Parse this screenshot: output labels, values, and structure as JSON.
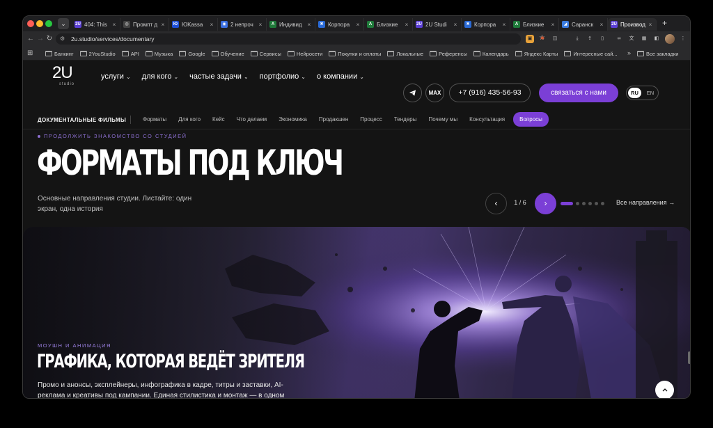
{
  "browser": {
    "tabs": [
      {
        "title": "404: This",
        "fav": "2U",
        "color": "#5b3fd6",
        "active": false
      },
      {
        "title": "Промпт д",
        "fav": "◎",
        "color": "#444",
        "active": false
      },
      {
        "title": "ЮKassa",
        "fav": "Ю",
        "color": "#1e4fd6",
        "active": false
      },
      {
        "title": "2 непроч",
        "fav": "◉",
        "color": "#3b6fe0",
        "active": false
      },
      {
        "title": "Индивид",
        "fav": "A",
        "color": "#1f7a3a",
        "active": false
      },
      {
        "title": "Корпора",
        "fav": "✖",
        "color": "#2a6ad6",
        "active": false
      },
      {
        "title": "Близкие",
        "fav": "A",
        "color": "#1f7a3a",
        "active": false
      },
      {
        "title": "2U Studi",
        "fav": "2U",
        "color": "#5b3fd6",
        "active": false
      },
      {
        "title": "Корпора",
        "fav": "✖",
        "color": "#2a6ad6",
        "active": false
      },
      {
        "title": "Близкие",
        "fav": "A",
        "color": "#1f7a3a",
        "active": false
      },
      {
        "title": "Саранск",
        "fav": "◢",
        "color": "#3a7be0",
        "active": false
      },
      {
        "title": "Производ",
        "fav": "2U",
        "color": "#5b3fd6",
        "active": true
      }
    ],
    "close_glyph": "×",
    "new_tab": "+",
    "url": "2u.studio/services/documentary",
    "bookmarks": [
      "Банкинг",
      "2YouStudio",
      "API",
      "Музыка",
      "Google",
      "Обучение",
      "Сервисы",
      "Нейросети",
      "Покупки и оплаты",
      "Локальные",
      "Референсы",
      "Календарь",
      "Яндекс Карты",
      "Интересные сай..."
    ],
    "bookmarks_more": "»",
    "all_bookmarks": "Все закладки"
  },
  "header": {
    "logo": "2U",
    "logo_sub": "studio",
    "nav": [
      "услуги",
      "для кого",
      "частые задачи",
      "портфолио",
      "о компании"
    ],
    "max_label": "MAX",
    "phone": "+7 (916) 435-56-93",
    "cta": "связаться с нами",
    "lang_active": "RU",
    "lang_other": "EN"
  },
  "subnav": {
    "title": "ДОКУМЕНТАЛЬНЫЕ ФИЛЬМЫ",
    "items": [
      "Форматы",
      "Для кого",
      "Кейс",
      "Что делаем",
      "Экономика",
      "Продакшен",
      "Процесс",
      "Тендеры",
      "Почему мы",
      "Консультация",
      "Вопросы"
    ],
    "active_index": 10
  },
  "hero": {
    "kicker": "ПРОДОЛЖИТЬ ЗНАКОМСТВО СО СТУДИЕЙ",
    "title": "ФОРМАТЫ ПОД КЛЮЧ",
    "desc": "Основные направления студии. Листайте: один экран, одна история",
    "counter": "1 / 6",
    "slide_count": 6,
    "active_slide": 1,
    "all_directions": "Все направления →"
  },
  "slide": {
    "kicker": "МОУШН И АНИМАЦИЯ",
    "title": "ГРАФИКА, КОТОРАЯ ВЕДЁТ ЗРИТЕЛЯ",
    "desc": "Промо и анонсы, эксплейнеры, инфографика в кадре, титры и заставки, AI-реклама и креативы под кампании. Единая стилистика и монтаж — в одном цикле с опытной командой профессионалов"
  },
  "colors": {
    "accent": "#7b3fd6",
    "background": "#141414"
  }
}
